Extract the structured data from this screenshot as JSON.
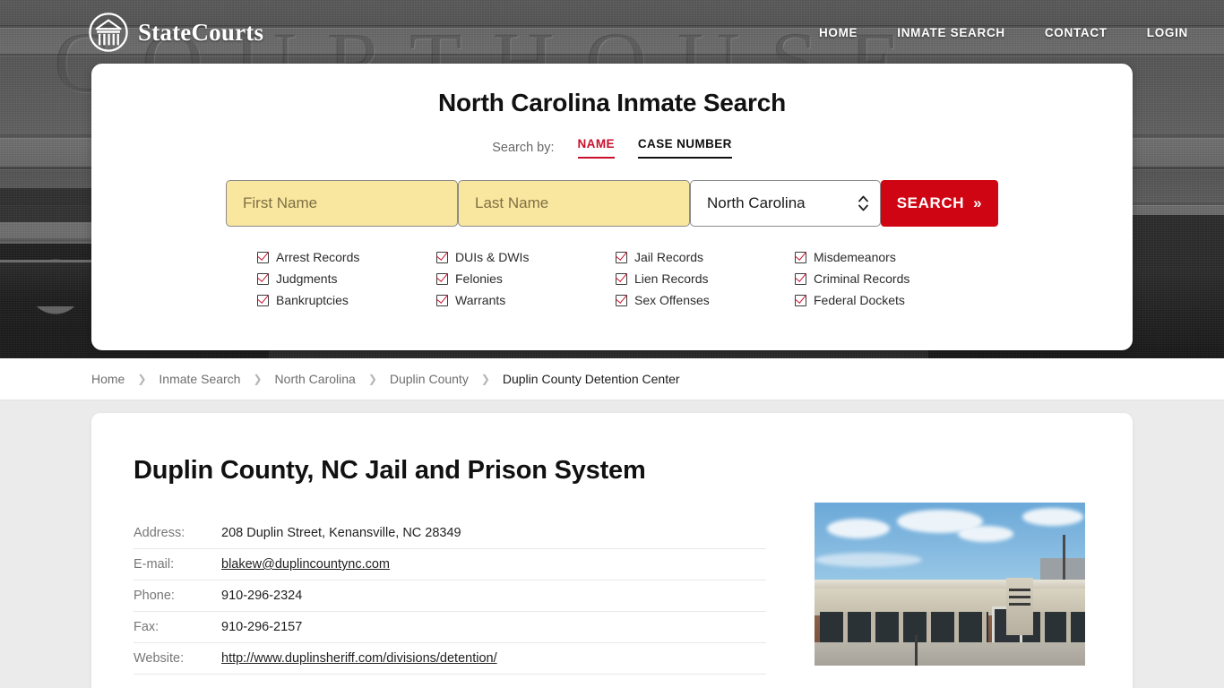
{
  "header": {
    "brand_name": "StateCourts",
    "brand_icon": "courthouse-circle-logo",
    "background_word": "COURTHOUSE",
    "nav": [
      {
        "label": "HOME"
      },
      {
        "label": "INMATE SEARCH"
      },
      {
        "label": "CONTACT"
      },
      {
        "label": "LOGIN"
      }
    ]
  },
  "search_card": {
    "title": "North Carolina Inmate Search",
    "search_by_label": "Search by:",
    "tabs": [
      {
        "label": "NAME",
        "active": true
      },
      {
        "label": "CASE NUMBER",
        "active": false
      }
    ],
    "first_name_placeholder": "First Name",
    "first_name_value": "",
    "last_name_placeholder": "Last Name",
    "last_name_value": "",
    "state_selected": "North Carolina",
    "search_button": "SEARCH",
    "search_button_chevron": "»",
    "accent_red": "#d00513",
    "field_yellow": "#fae79f",
    "checkbox_items": [
      "Arrest Records",
      "DUIs & DWIs",
      "Jail Records",
      "Misdemeanors",
      "Judgments",
      "Felonies",
      "Lien Records",
      "Criminal Records",
      "Bankruptcies",
      "Warrants",
      "Sex Offenses",
      "Federal Dockets"
    ]
  },
  "breadcrumb": {
    "separator": "❯",
    "items": [
      {
        "label": "Home",
        "current": false
      },
      {
        "label": "Inmate Search",
        "current": false
      },
      {
        "label": "North Carolina",
        "current": false
      },
      {
        "label": "Duplin County",
        "current": false
      },
      {
        "label": "Duplin County Detention Center",
        "current": true
      }
    ]
  },
  "main": {
    "page_title": "Duplin County, NC Jail and Prison System",
    "info_rows": [
      {
        "key": "Address:",
        "value": "208 Duplin Street, Kenansville, NC 28349",
        "link": false
      },
      {
        "key": "E-mail:",
        "value": "blakew@duplincountync.com",
        "link": true
      },
      {
        "key": "Phone:",
        "value": "910-296-2324",
        "link": false
      },
      {
        "key": "Fax:",
        "value": "910-296-2157",
        "link": false
      },
      {
        "key": "Website:",
        "value": "http://www.duplinsheriff.com/divisions/detention/",
        "link": true
      }
    ],
    "photo_alt": "duplin-county-detention-center-photo"
  }
}
